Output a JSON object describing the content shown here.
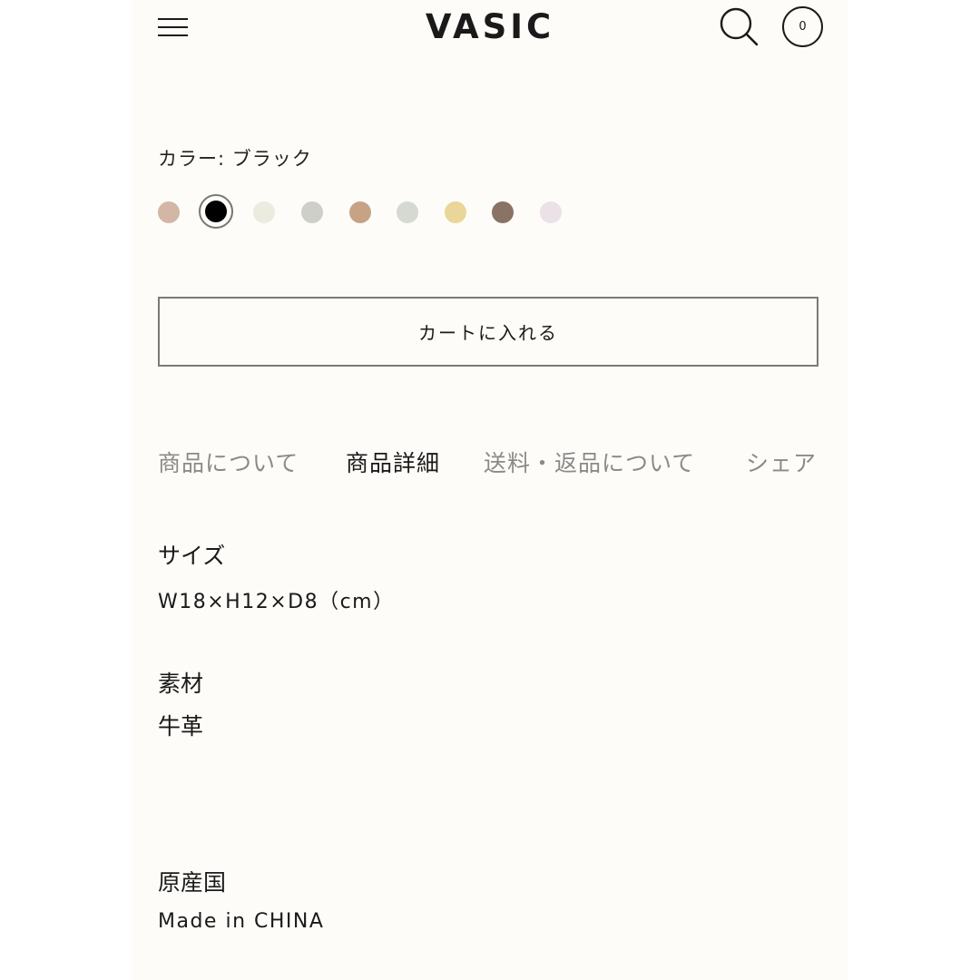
{
  "header": {
    "logo": "VASIC",
    "cart_count": "0"
  },
  "color": {
    "label": "カラー: ブラック",
    "swatches": [
      "#d4b6a6",
      "#000000",
      "#ecebdf",
      "#cfcfca",
      "#c7a386",
      "#d6d8d2",
      "#ead699",
      "#8a7264",
      "#ebe1e6"
    ],
    "selected_index": 1
  },
  "add_to_cart": "カートに入れる",
  "tabs": [
    {
      "label": "商品について",
      "active": false
    },
    {
      "label": "商品詳細",
      "active": true
    },
    {
      "label": "送料・返品について",
      "active": false
    },
    {
      "label": "シェア",
      "active": false
    }
  ],
  "details": {
    "size_label": "サイズ",
    "size_value": "W18×H12×D8（cm）",
    "material_label": "素材",
    "material_value": "牛革",
    "origin_label": "原産国",
    "origin_value": "Made in CHINA"
  }
}
